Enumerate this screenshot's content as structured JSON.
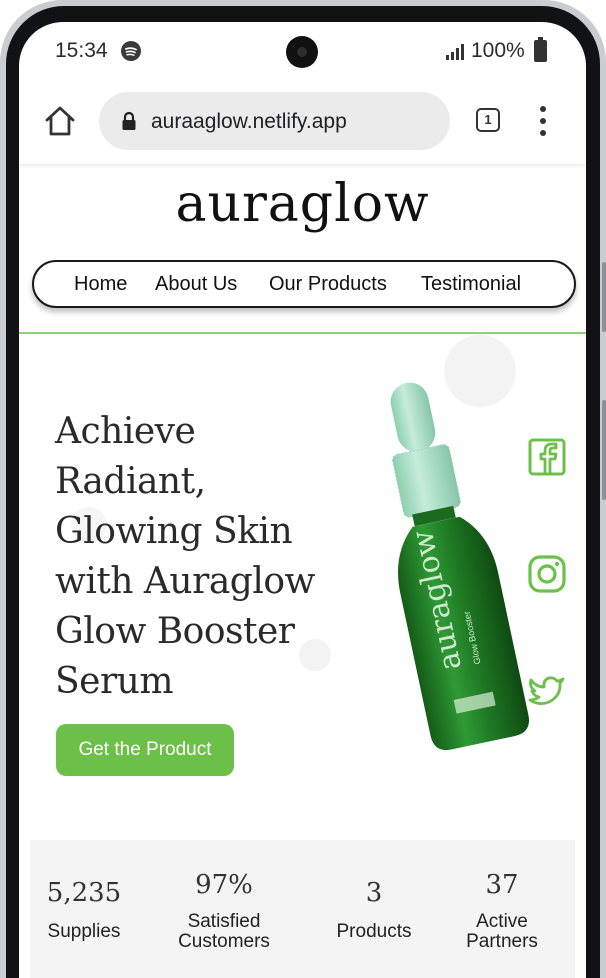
{
  "status_bar": {
    "time": "15:34",
    "battery": "100%"
  },
  "browser": {
    "url": "auraaglow.netlify.app",
    "tab_count": "1"
  },
  "site": {
    "logo": "auraglow",
    "nav": [
      "Home",
      "About Us",
      "Our Products",
      "Testimonial"
    ],
    "hero_title": "Achieve Radiant, Glowing Skin with Auraglow Glow Booster Serum",
    "cta_label": "Get the Product",
    "bottle_label": "auraglow",
    "bottle_sublabel": "Glow Booster",
    "social_icons": [
      "facebook-icon",
      "instagram-icon",
      "twitter-icon"
    ],
    "stats": [
      {
        "value": "5,235",
        "label": "Supplies"
      },
      {
        "value": "97%",
        "label": "Satisfied Customers"
      },
      {
        "value": "3",
        "label": "Products"
      },
      {
        "value": "37",
        "label": "Active Partners"
      }
    ]
  },
  "colors": {
    "accent": "#6cc04a",
    "bottle": "#1f7a24",
    "cap": "#a8dcc4"
  }
}
